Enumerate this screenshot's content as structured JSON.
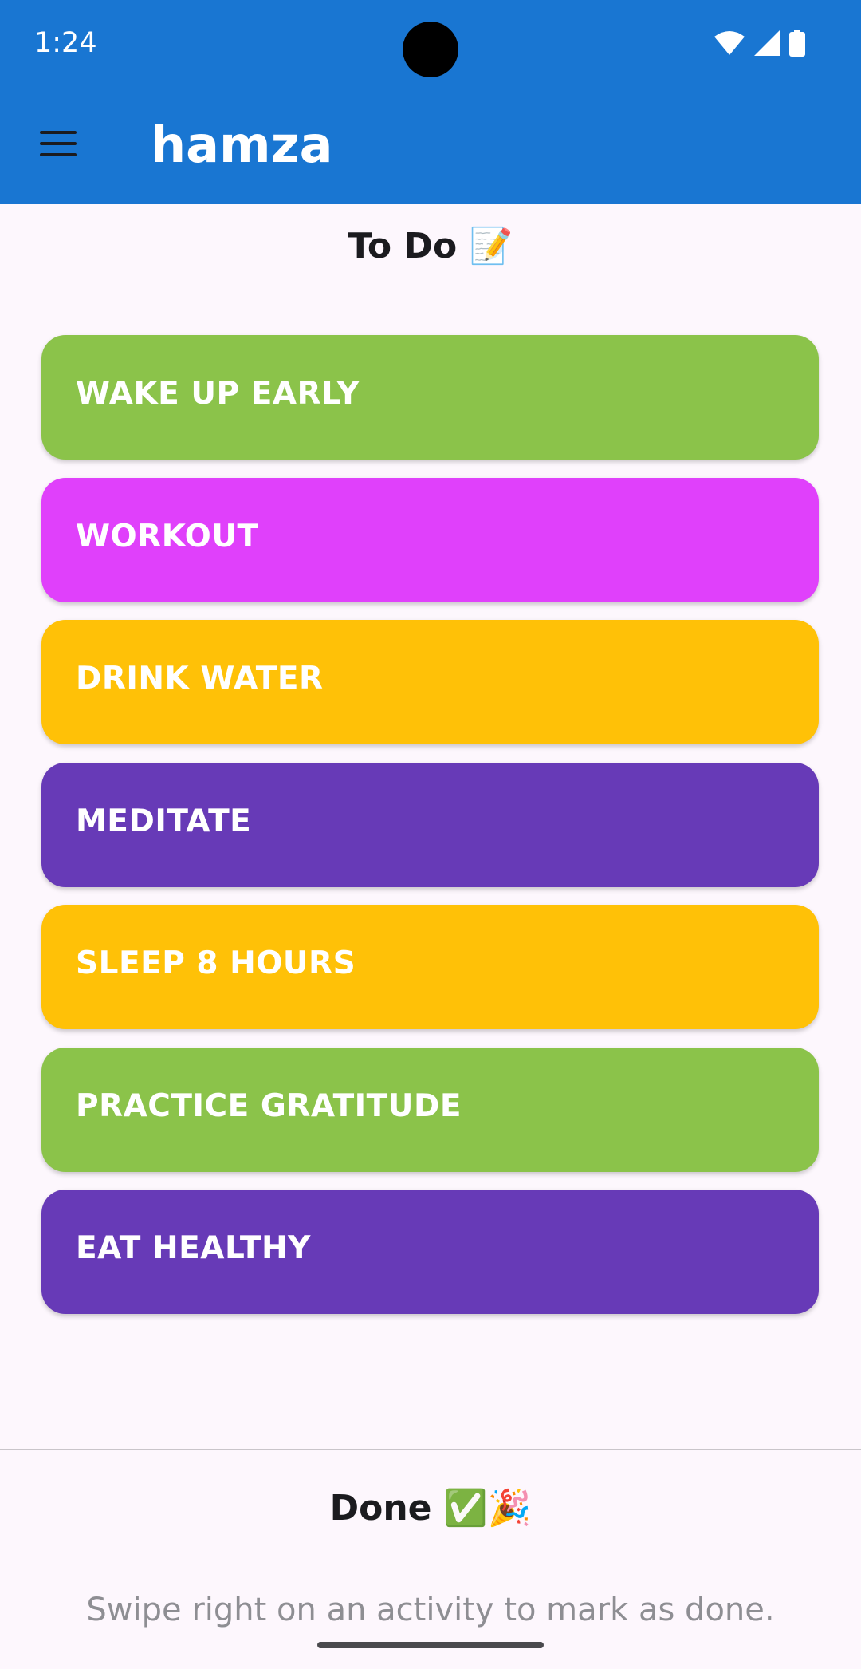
{
  "status_bar": {
    "time": "1:24",
    "icons": [
      "wifi-icon",
      "signal-icon",
      "battery-icon"
    ]
  },
  "app_bar": {
    "menu_icon": "menu-icon",
    "title": "hamza",
    "background": "#1976D2"
  },
  "todo_section": {
    "title": "To Do",
    "emoji": "📝"
  },
  "activities": [
    {
      "label": "WAKE UP EARLY",
      "color": "#8BC34A"
    },
    {
      "label": "WORKOUT",
      "color": "#E040FB"
    },
    {
      "label": "DRINK WATER",
      "color": "#FFC107"
    },
    {
      "label": "MEDITATE",
      "color": "#673AB7"
    },
    {
      "label": "SLEEP 8 HOURS",
      "color": "#FFC107"
    },
    {
      "label": "PRACTICE GRATITUDE",
      "color": "#8BC34A"
    },
    {
      "label": "EAT HEALTHY",
      "color": "#673AB7"
    }
  ],
  "done_section": {
    "title": "Done",
    "emoji": "✅🎉",
    "hint": "Swipe right on an activity to mark as done."
  }
}
